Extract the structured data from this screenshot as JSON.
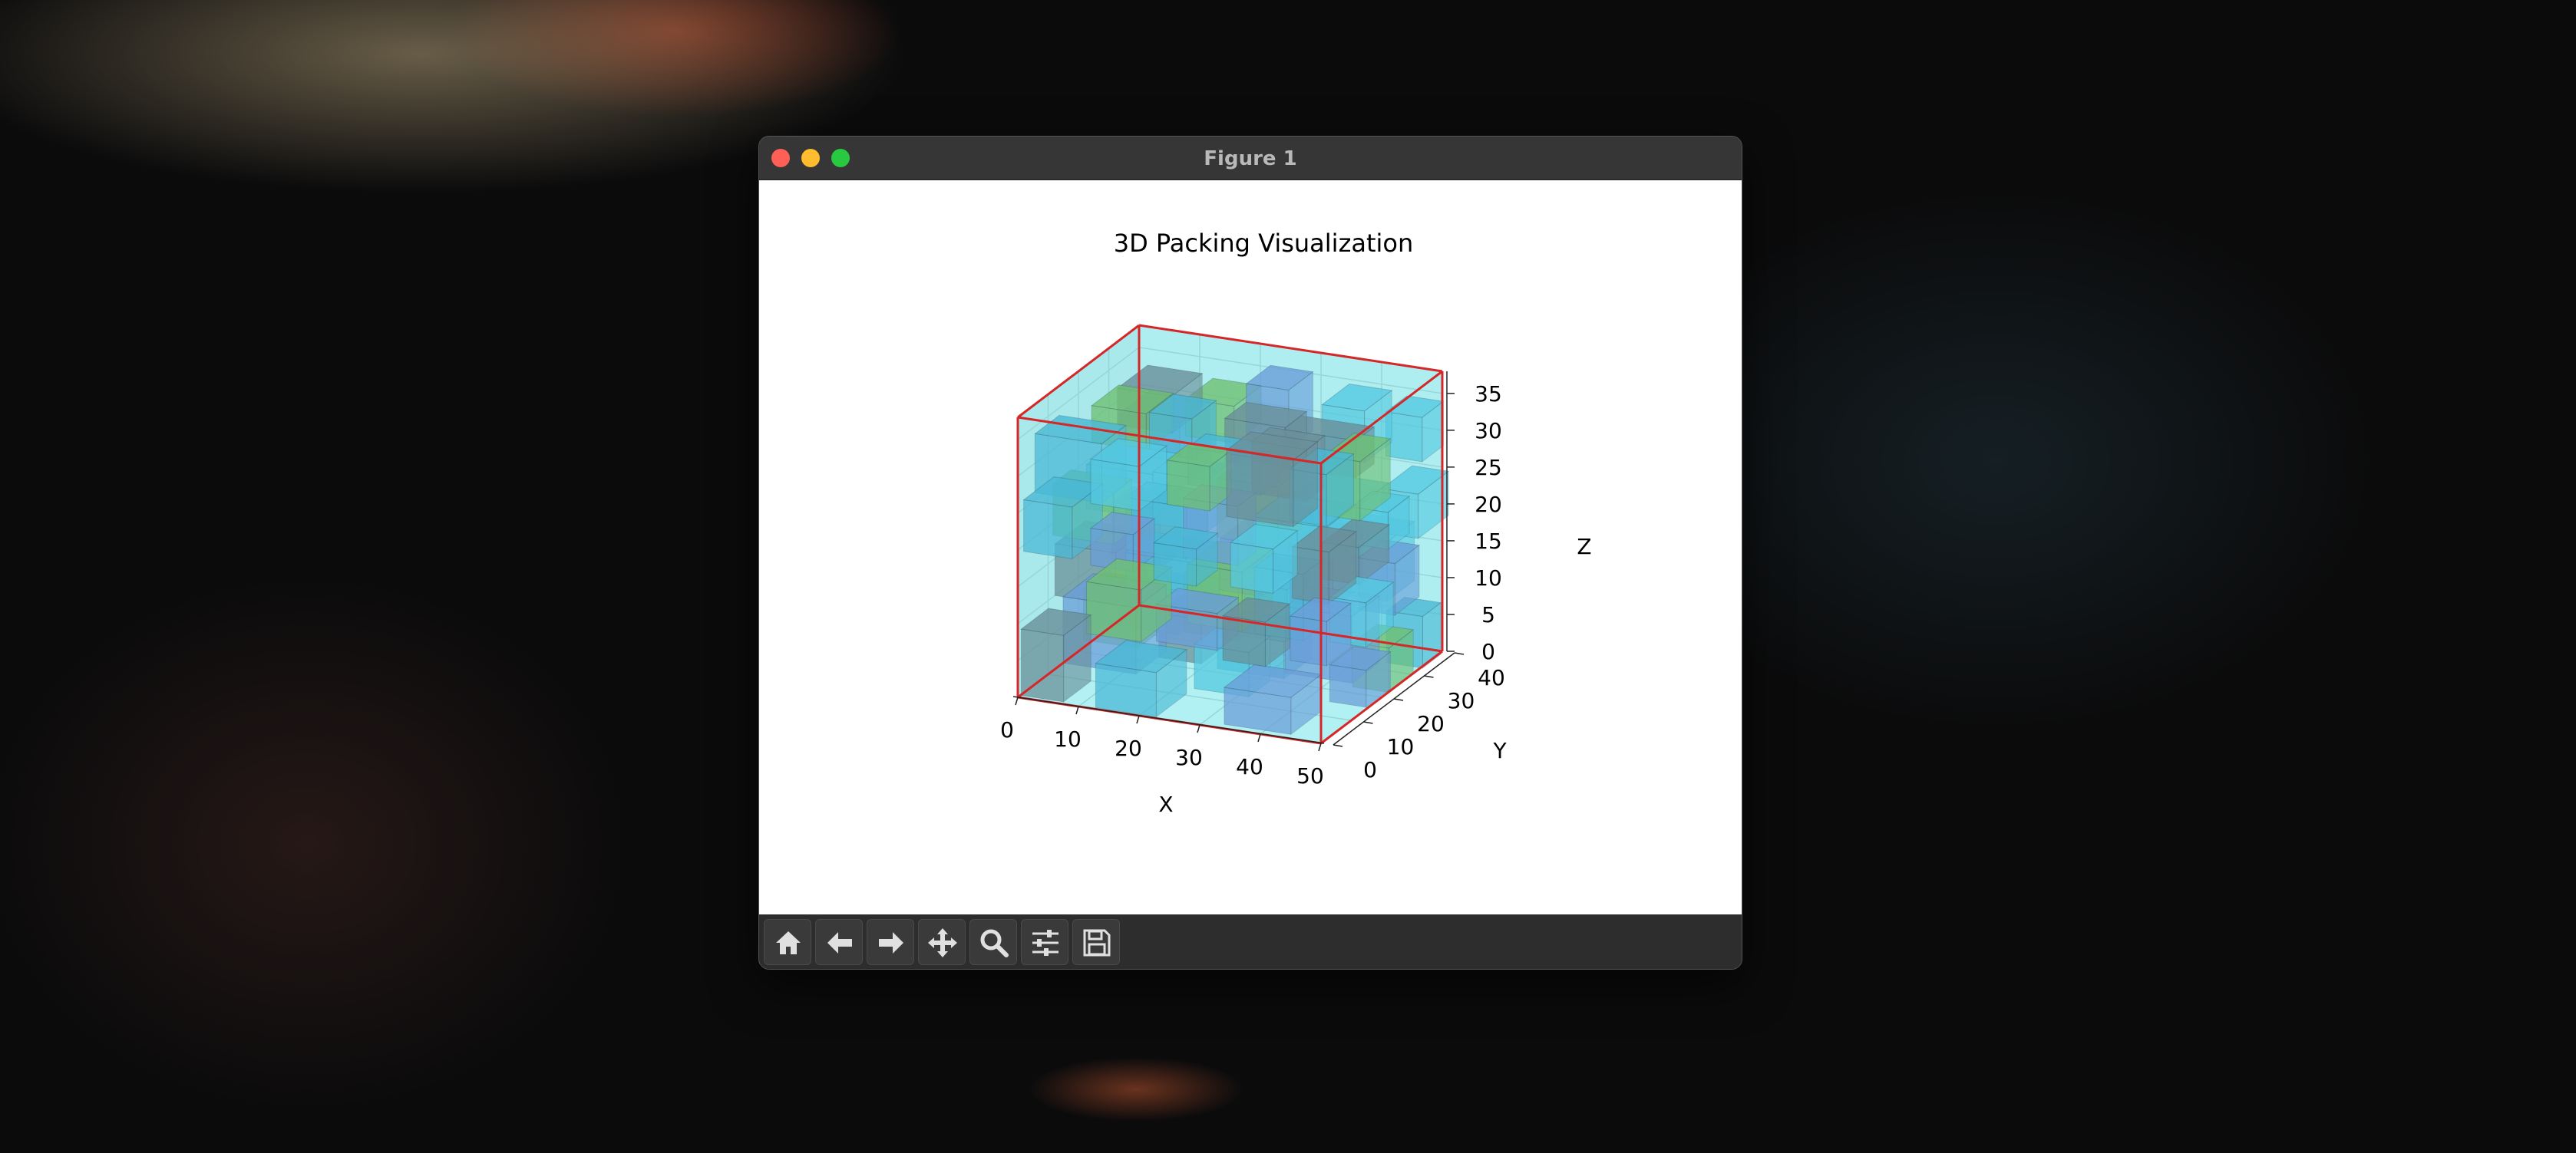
{
  "window": {
    "title": "Figure 1"
  },
  "toolbar": {
    "icons": [
      "home-icon",
      "back-arrow-icon",
      "forward-arrow-icon",
      "pan-icon",
      "zoom-icon",
      "configure-subplots-icon",
      "save-icon"
    ]
  },
  "chart_data": {
    "type": "3d-box",
    "title": "3D Packing Visualization",
    "xlabel": "X",
    "ylabel": "Y",
    "zlabel": "Z",
    "x_ticks": [
      "0",
      "10",
      "20",
      "30",
      "40",
      "50"
    ],
    "y_ticks": [
      "0",
      "10",
      "20",
      "30",
      "40"
    ],
    "z_ticks": [
      "0",
      "5",
      "10",
      "15",
      "20",
      "25",
      "30",
      "35"
    ],
    "xlim": [
      0,
      50
    ],
    "ylim": [
      0,
      40
    ],
    "zlim": [
      0,
      38
    ],
    "container": {
      "size": [
        50,
        40,
        38
      ],
      "edge_color": "#d62728",
      "fill_color": "#00e5ee"
    },
    "box_colors": [
      "#4ab8d6",
      "#6fbf73",
      "#6a9fd8",
      "#6a8f9a",
      "#55c9e0"
    ]
  }
}
